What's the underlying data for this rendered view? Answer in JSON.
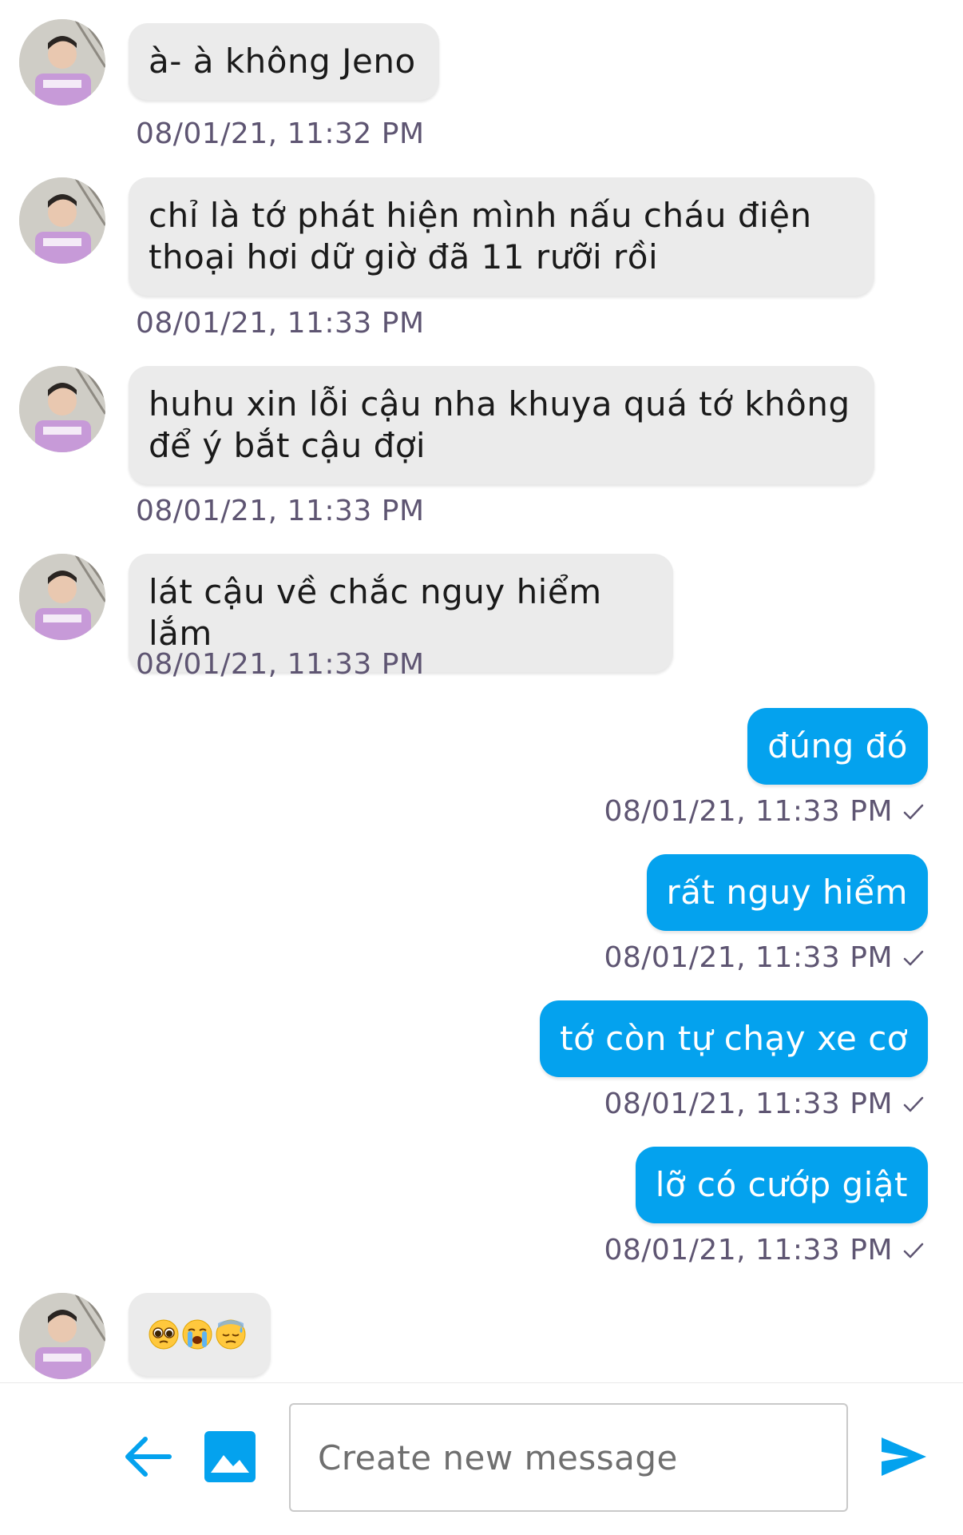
{
  "messages": [
    {
      "direction": "in",
      "text": "à- à không Jeno",
      "time": "08/01/21, 11:32 PM"
    },
    {
      "direction": "in",
      "text": "chỉ là tớ phát hiện mình nấu cháu điện thoại hơi dữ giờ đã 11 rưỡi rồi",
      "time": "08/01/21, 11:33 PM"
    },
    {
      "direction": "in",
      "text": "huhu xin lỗi cậu nha khuya quá tớ không để ý bắt cậu đợi",
      "time": "08/01/21, 11:33 PM"
    },
    {
      "direction": "in",
      "text": "lát cậu về chắc nguy hiểm lắm",
      "time": "08/01/21, 11:33 PM"
    },
    {
      "direction": "out",
      "text": "đúng đó",
      "time": "08/01/21, 11:33 PM"
    },
    {
      "direction": "out",
      "text": "rất nguy hiểm",
      "time": "08/01/21, 11:33 PM"
    },
    {
      "direction": "out",
      "text": "tớ còn tự chạy xe cơ",
      "time": "08/01/21, 11:33 PM"
    },
    {
      "direction": "out",
      "text": "lỡ có cướp giật",
      "time": "08/01/21, 11:33 PM"
    },
    {
      "direction": "in",
      "emojis": [
        "pleading-face",
        "loudly-crying-face",
        "downcast-face-with-sweat"
      ]
    }
  ],
  "compose": {
    "placeholder": "Create new message",
    "value": ""
  },
  "icons": {
    "back": "arrow-left-icon",
    "image": "image-icon",
    "send": "send-icon",
    "check": "check-icon"
  },
  "colors": {
    "accent": "#04a2ee",
    "incoming_bubble": "#ebebeb",
    "timestamp": "#5e5572"
  }
}
